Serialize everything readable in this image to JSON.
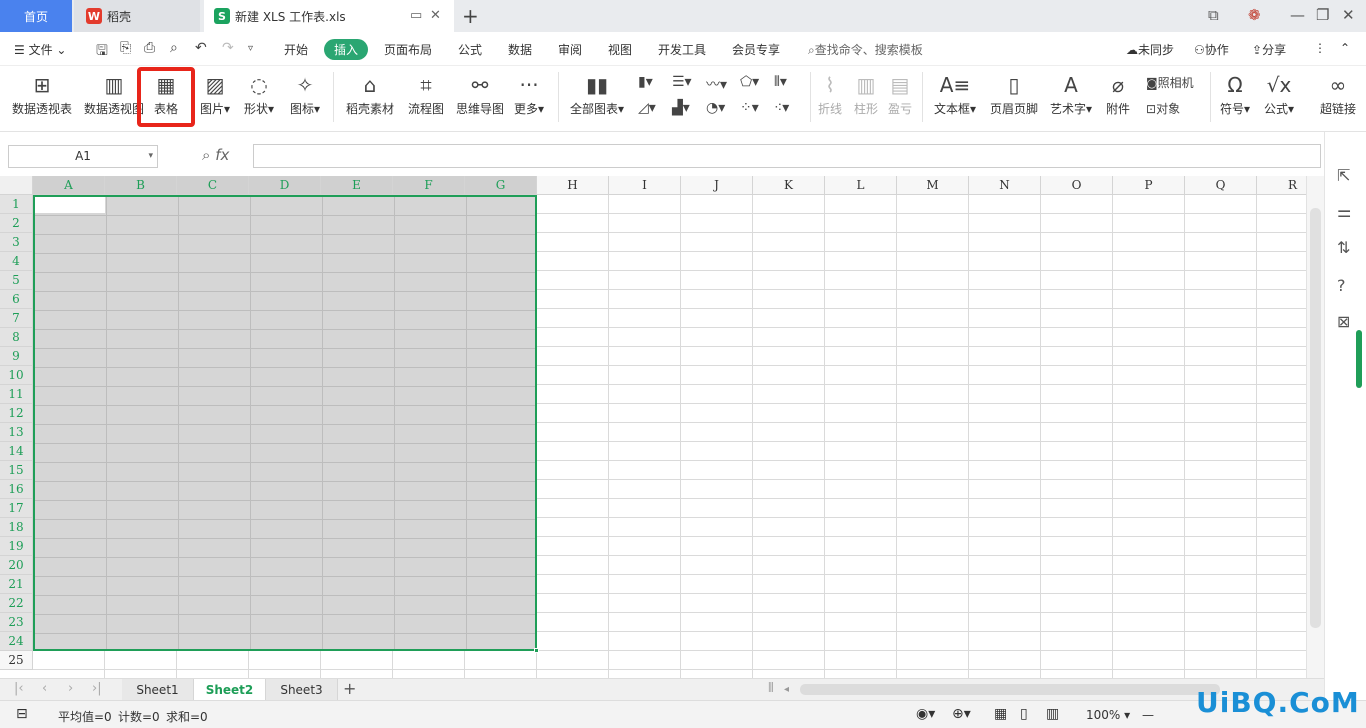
{
  "tabs": {
    "home": "首页",
    "daoke": "稻壳",
    "file": "新建 XLS 工作表.xls"
  },
  "menu": {
    "file": "文件",
    "items": [
      "开始",
      "插入",
      "页面布局",
      "公式",
      "数据",
      "审阅",
      "视图",
      "开发工具",
      "会员专享"
    ],
    "search": "查找命令、搜索模板",
    "sync": "未同步",
    "collab": "协作",
    "share": "分享"
  },
  "ribbon": {
    "pivot": "数据透视表",
    "pivotchart": "数据透视图",
    "table": "表格",
    "picture": "图片",
    "shape": "形状",
    "icon": "图标",
    "material": "稻壳素材",
    "flow": "流程图",
    "mind": "思维导图",
    "more": "更多",
    "allcharts": "全部图表",
    "line": "折线",
    "col": "柱形",
    "wl": "盈亏",
    "textbox": "文本框",
    "header": "页眉页脚",
    "art": "艺术字",
    "attach": "附件",
    "camera": "照相机",
    "object": "对象",
    "symbol": "符号",
    "formula": "公式",
    "hyperlink": "超链接"
  },
  "namebox": "A1",
  "fx": "fx",
  "columns": [
    "A",
    "B",
    "C",
    "D",
    "E",
    "F",
    "G",
    "H",
    "I",
    "J",
    "K",
    "L",
    "M",
    "N",
    "O",
    "P",
    "Q",
    "R"
  ],
  "rows": [
    "1",
    "2",
    "3",
    "4",
    "5",
    "6",
    "7",
    "8",
    "9",
    "10",
    "11",
    "12",
    "13",
    "14",
    "15",
    "16",
    "17",
    "18",
    "19",
    "20",
    "21",
    "22",
    "23",
    "24",
    "25"
  ],
  "sheets": [
    "Sheet1",
    "Sheet2",
    "Sheet3"
  ],
  "status": {
    "avg": "平均值=0",
    "count": "计数=0",
    "sum": "求和=0",
    "zoom": "100%"
  },
  "watermark": "UiBQ.CoM"
}
